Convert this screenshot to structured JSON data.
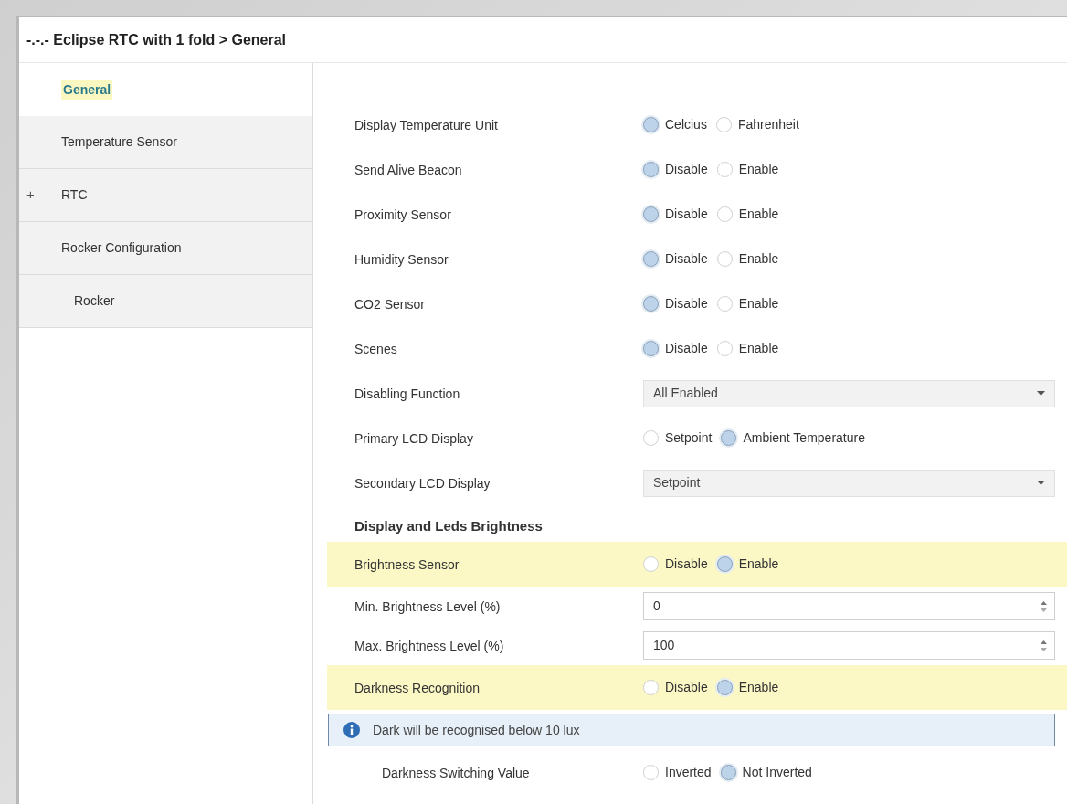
{
  "window": {
    "title": "-.-.- Eclipse RTC with 1 fold > General"
  },
  "sidebar": {
    "items": [
      {
        "label": "General",
        "selected": true
      },
      {
        "label": "Temperature Sensor",
        "selected": false
      },
      {
        "label": "RTC",
        "selected": false,
        "toggle": "+"
      },
      {
        "label": "Rocker Configuration",
        "selected": false,
        "children": [
          {
            "label": "Rocker",
            "selected": false
          }
        ]
      }
    ]
  },
  "parameters": [
    {
      "kind": "radio",
      "label": "Display Temperature Unit",
      "options": [
        {
          "label": "Celcius",
          "selected": true
        },
        {
          "label": "Fahrenheit",
          "selected": false
        }
      ]
    },
    {
      "kind": "radio",
      "label": "Send Alive Beacon",
      "options": [
        {
          "label": "Disable",
          "selected": true
        },
        {
          "label": "Enable",
          "selected": false
        }
      ]
    },
    {
      "kind": "radio",
      "label": "Proximity Sensor",
      "options": [
        {
          "label": "Disable",
          "selected": true
        },
        {
          "label": "Enable",
          "selected": false
        }
      ]
    },
    {
      "kind": "radio",
      "label": "Humidity Sensor",
      "options": [
        {
          "label": "Disable",
          "selected": true
        },
        {
          "label": "Enable",
          "selected": false
        }
      ]
    },
    {
      "kind": "radio",
      "label": "CO2 Sensor",
      "options": [
        {
          "label": "Disable",
          "selected": true
        },
        {
          "label": "Enable",
          "selected": false
        }
      ]
    },
    {
      "kind": "radio",
      "label": "Scenes",
      "options": [
        {
          "label": "Disable",
          "selected": true
        },
        {
          "label": "Enable",
          "selected": false
        }
      ]
    },
    {
      "kind": "select",
      "label": "Disabling Function",
      "value": "All Enabled"
    },
    {
      "kind": "radio",
      "label": "Primary LCD Display",
      "options": [
        {
          "label": "Setpoint",
          "selected": false
        },
        {
          "label": "Ambient Temperature",
          "selected": true
        }
      ]
    },
    {
      "kind": "select",
      "label": "Secondary LCD Display",
      "value": "Setpoint"
    },
    {
      "kind": "heading",
      "label": "Display and Leds Brightness"
    },
    {
      "kind": "radio",
      "label": "Brightness Sensor",
      "highlighted": true,
      "options": [
        {
          "label": "Disable",
          "selected": false
        },
        {
          "label": "Enable",
          "selected": true
        }
      ]
    },
    {
      "kind": "spin",
      "label": "Min. Brightness Level (%)",
      "value": "0"
    },
    {
      "kind": "spin",
      "label": "Max. Brightness Level (%)",
      "value": "100"
    },
    {
      "kind": "radio",
      "label": "Darkness Recognition",
      "highlighted": true,
      "options": [
        {
          "label": "Disable",
          "selected": false
        },
        {
          "label": "Enable",
          "selected": true
        }
      ],
      "children": [
        {
          "kind": "info",
          "label": "Dark will be recognised below 10 lux"
        },
        {
          "kind": "radio",
          "label": "Darkness Switching Value",
          "options": [
            {
              "label": "Inverted",
              "selected": false
            },
            {
              "label": "Not Inverted",
              "selected": true
            }
          ]
        }
      ]
    }
  ]
}
